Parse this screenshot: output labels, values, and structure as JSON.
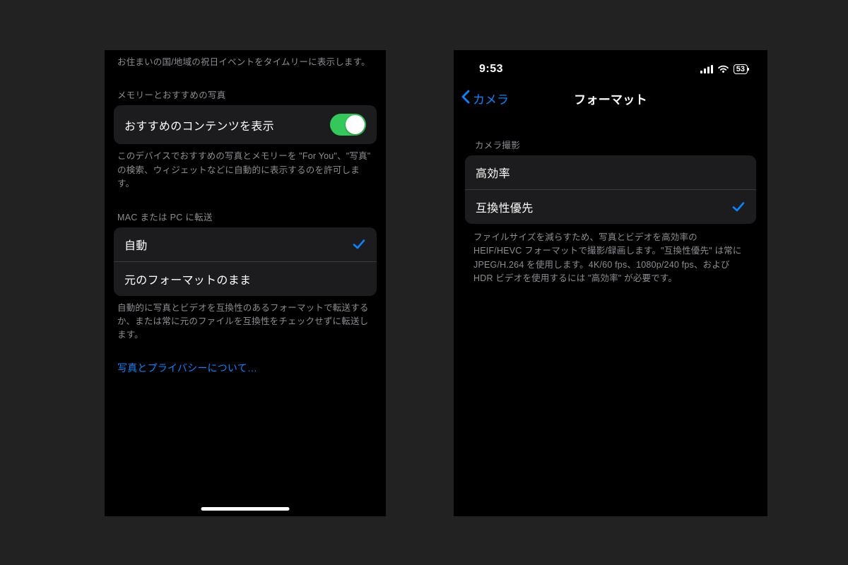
{
  "left": {
    "holiday_footer": "お住まいの国/地域の祝日イベントをタイムリーに表示します。",
    "memories_header": "メモリーとおすすめの写真",
    "show_featured_label": "おすすめのコンテンツを表示",
    "show_featured_on": true,
    "memories_footer": "このデバイスでおすすめの写真とメモリーを \"For You\"、\"写真\" の検索、ウィジェットなどに自動的に表示するのを許可します。",
    "transfer_header": "MAC または PC に転送",
    "options": [
      {
        "label": "自動",
        "selected": true
      },
      {
        "label": "元のフォーマットのまま",
        "selected": false
      }
    ],
    "transfer_footer": "自動的に写真とビデオを互換性のあるフォーマットで転送するか、または常に元のファイルを互換性をチェックせずに転送します。",
    "privacy_link": "写真とプライバシーについて…"
  },
  "right": {
    "status_time": "9:53",
    "battery_text": "53",
    "back_label": "カメラ",
    "nav_title": "フォーマット",
    "capture_header": "カメラ撮影",
    "options": [
      {
        "label": "高効率",
        "selected": false
      },
      {
        "label": "互換性優先",
        "selected": true
      }
    ],
    "capture_footer": "ファイルサイズを減らすため、写真とビデオを高効率の HEIF/HEVC フォーマットで撮影/録画します。\"互換性優先\" は常に JPEG/H.264 を使用します。4K/60 fps、1080p/240 fps、および HDR ビデオを使用するには \"高効率\" が必要です。"
  },
  "colors": {
    "accent": "#0a84ff",
    "toggle_on": "#34c759",
    "cell_bg": "#1c1c1e"
  }
}
